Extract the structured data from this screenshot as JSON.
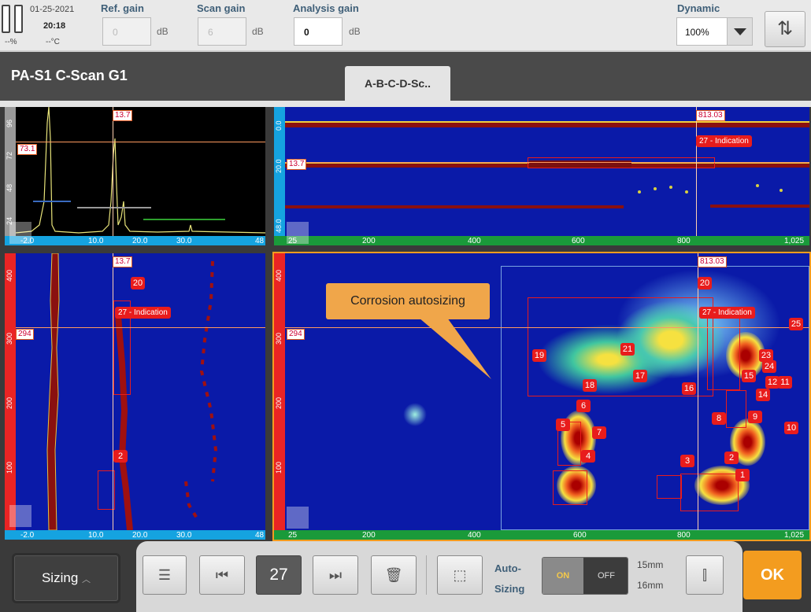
{
  "status": {
    "date": "01-25-2021",
    "time": "20:18",
    "battery": "--%",
    "temperature": "--°C"
  },
  "gains": {
    "ref_label": "Ref. gain",
    "ref_value": "0",
    "ref_unit": "dB",
    "scan_label": "Scan gain",
    "scan_value": "6",
    "scan_unit": "dB",
    "analysis_label": "Analysis gain",
    "analysis_value": "0",
    "analysis_unit": "dB"
  },
  "dynamic": {
    "label": "Dynamic",
    "value": "100%"
  },
  "page_title": "PA-S1 C-Scan G1",
  "tab_label": "A-B-C-D-Sc..",
  "ascan": {
    "y_ticks": [
      "96",
      "72",
      "48",
      "24"
    ],
    "x_ticks": [
      "-2.0",
      "10.0",
      "20.0",
      "30.0",
      "48"
    ],
    "cursor_x": "13.7",
    "cursor_y": "73.1"
  },
  "bscan": {
    "y_ticks": [
      "0.0",
      "20.0",
      "48.0"
    ],
    "x_ticks": [
      "25",
      "200",
      "400",
      "600",
      "800",
      "1,025"
    ],
    "cursor_x": "813.03",
    "cursor_y": "13.7",
    "indication": "27 - Indication"
  },
  "dscan": {
    "y_ticks": [
      "400",
      "300",
      "200",
      "100"
    ],
    "x_ticks": [
      "-2.0",
      "10.0",
      "20.0",
      "30.0",
      "48"
    ],
    "cursor_x": "13.7",
    "cursor_y": "294",
    "indication": "27 - Indication",
    "labels": [
      "20",
      "2"
    ]
  },
  "cscan": {
    "y_ticks": [
      "400",
      "300",
      "200",
      "100"
    ],
    "x_ticks": [
      "25",
      "200",
      "400",
      "600",
      "800",
      "1,025"
    ],
    "cursor_x": "813.03",
    "cursor_y": "294",
    "indication": "27 - Indication",
    "callout": "Corrosion autosizing",
    "labels": [
      "20",
      "25",
      "19",
      "21",
      "23",
      "24",
      "17",
      "18",
      "16",
      "15",
      "12",
      "11",
      "14",
      "6",
      "9",
      "8",
      "10",
      "5",
      "7",
      "4",
      "3",
      "2",
      "1"
    ]
  },
  "toolbar": {
    "sizing_label": "Sizing",
    "indication_number": "27",
    "auto_label_1": "Auto-",
    "auto_label_2": "Sizing",
    "on_label": "ON",
    "off_label": "OFF",
    "size_1": "15mm",
    "size_2": "16mm",
    "ok_label": "OK"
  }
}
